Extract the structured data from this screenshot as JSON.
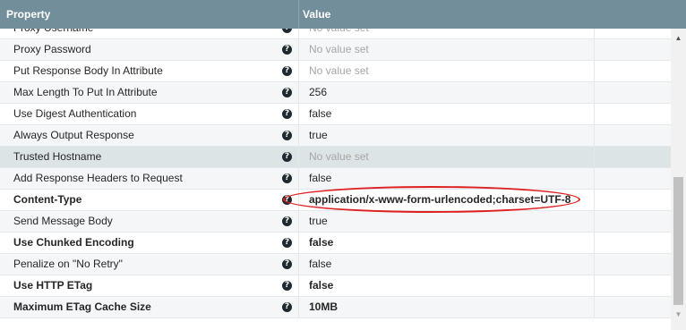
{
  "header": {
    "property": "Property",
    "value": "Value"
  },
  "properties": [
    {
      "name": "Proxy Username",
      "value": "No value set",
      "set": false,
      "bold": false
    },
    {
      "name": "Proxy Password",
      "value": "No value set",
      "set": false,
      "bold": false
    },
    {
      "name": "Put Response Body In Attribute",
      "value": "No value set",
      "set": false,
      "bold": false
    },
    {
      "name": "Max Length To Put In Attribute",
      "value": "256",
      "set": true,
      "bold": false
    },
    {
      "name": "Use Digest Authentication",
      "value": "false",
      "set": true,
      "bold": false
    },
    {
      "name": "Always Output Response",
      "value": "true",
      "set": true,
      "bold": false
    },
    {
      "name": "Trusted Hostname",
      "value": "No value set",
      "set": false,
      "bold": false
    },
    {
      "name": "Add Response Headers to Request",
      "value": "false",
      "set": true,
      "bold": false
    },
    {
      "name": "Content-Type",
      "value": "application/x-www-form-urlencoded;charset=UTF-8",
      "set": true,
      "bold": true
    },
    {
      "name": "Send Message Body",
      "value": "true",
      "set": true,
      "bold": false
    },
    {
      "name": "Use Chunked Encoding",
      "value": "false",
      "set": true,
      "bold": true
    },
    {
      "name": "Penalize on \"No Retry\"",
      "value": "false",
      "set": true,
      "bold": false
    },
    {
      "name": "Use HTTP ETag",
      "value": "false",
      "set": true,
      "bold": true
    },
    {
      "name": "Maximum ETag Cache Size",
      "value": "10MB",
      "set": true,
      "bold": true
    }
  ],
  "icons": {
    "help": "question-circle-icon",
    "help_glyph": "?"
  },
  "colors": {
    "header_bg": "#728e9b",
    "highlight_circle": "#e02020",
    "muted_text": "#a6a6a6"
  }
}
